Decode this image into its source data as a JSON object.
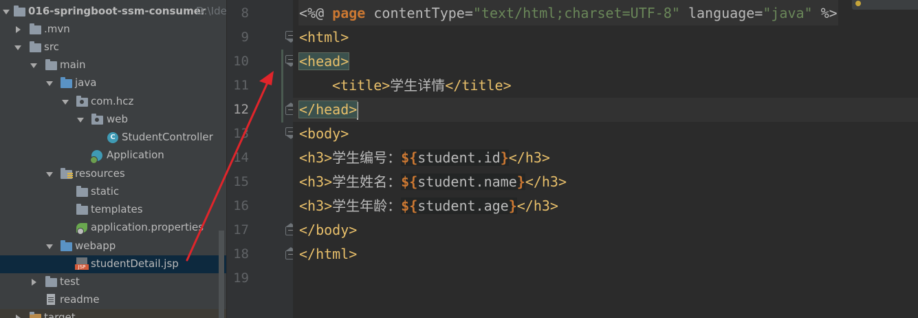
{
  "project_tree": {
    "root": {
      "label": "016-springboot-ssm-consumer",
      "path_hint": "D:\\Idea"
    },
    "items": [
      {
        "label": ".mvn"
      },
      {
        "label": "src"
      },
      {
        "label": "main"
      },
      {
        "label": "java"
      },
      {
        "label": "com.hcz"
      },
      {
        "label": "web"
      },
      {
        "label": "StudentController"
      },
      {
        "label": "Application"
      },
      {
        "label": "resources"
      },
      {
        "label": "static"
      },
      {
        "label": "templates"
      },
      {
        "label": "application.properties"
      },
      {
        "label": "webapp"
      },
      {
        "label": "studentDetail.jsp"
      },
      {
        "label": "test"
      },
      {
        "label": "readme"
      },
      {
        "label": "target"
      }
    ]
  },
  "editor": {
    "line_numbers": [
      "8",
      "9",
      "10",
      "11",
      "12",
      "13",
      "14",
      "15",
      "16",
      "17",
      "18",
      "19"
    ],
    "lines": {
      "l8": {
        "open": "<%@",
        "directive": "page",
        "attr1": "contentType=",
        "val1": "\"text/html;charset=UTF-8\"",
        "attr2": "language=",
        "val2": "\"java\"",
        "close": "%>"
      },
      "l9": "<html>",
      "l10": "<head>",
      "l11": {
        "open": "<title>",
        "text": "学生详情",
        "close": "</title>"
      },
      "l12": "</head>",
      "l13": "<body>",
      "l14": {
        "open": "<h3>",
        "text": "学生编号：",
        "el_start": "${",
        "el_expr": "student.id",
        "el_end": "}",
        "close": "</h3>"
      },
      "l15": {
        "open": "<h3>",
        "text": "学生姓名：",
        "el_start": "${",
        "el_expr": "student.name",
        "el_end": "}",
        "close": "</h3>"
      },
      "l16": {
        "open": "<h3>",
        "text": "学生年龄：",
        "el_start": "${",
        "el_expr": "student.age",
        "el_end": "}",
        "close": "</h3>"
      },
      "l17": "</body>",
      "l18": "</html>"
    }
  },
  "colors": {
    "tree_bg": "#3c3f41",
    "editor_bg": "#2b2b2b",
    "tag": "#e8bf6a",
    "string": "#6a8759",
    "keyword": "#cc7832",
    "annotation_arrow": "#e0252b",
    "selection": "#0d293e"
  }
}
